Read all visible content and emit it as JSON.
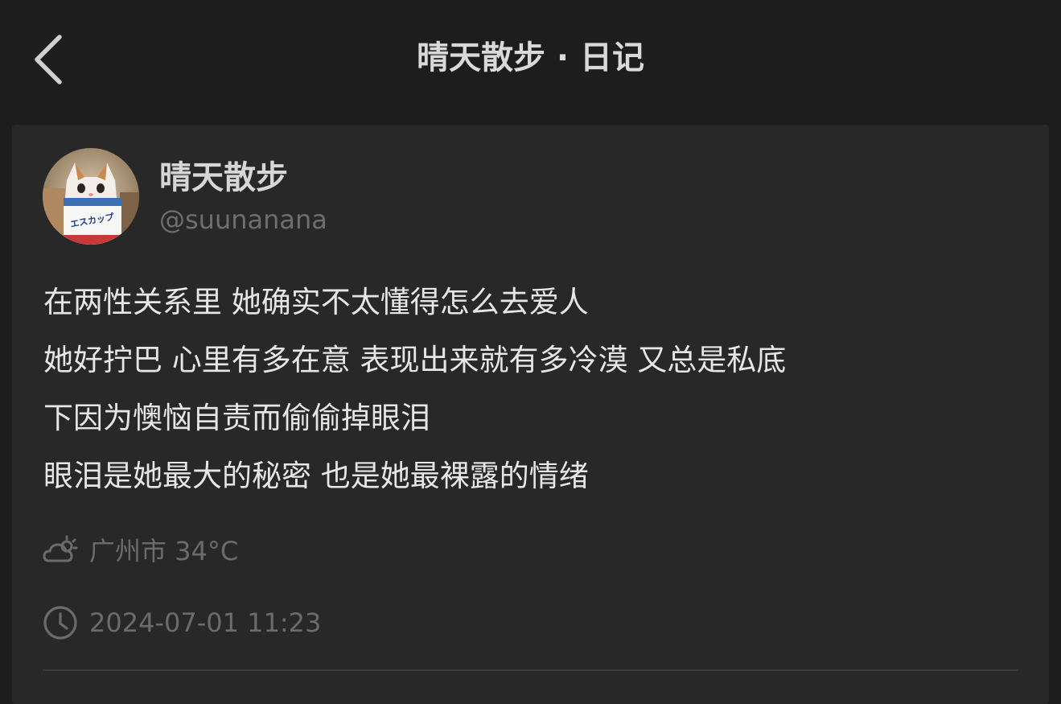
{
  "header": {
    "title": "晴天散步 · 日记",
    "back_icon": "chevron-left-icon"
  },
  "post": {
    "author_name": "晴天散步",
    "author_handle": "@suunanana",
    "avatar_text": "エスカップ",
    "lines": [
      "在两性关系里 她确实不太懂得怎么去爱人",
      "她好拧巴 心里有多在意 表现出来就有多冷漠 又总是私底",
      "下因为懊恼自责而偷偷掉眼泪",
      "眼泪是她最大的秘密 也是她最裸露的情绪"
    ],
    "weather": {
      "icon": "partly-cloudy-icon",
      "text": "广州市 34°C"
    },
    "time": {
      "icon": "clock-icon",
      "text": "2024-07-01 11:23"
    }
  },
  "colors": {
    "background": "#1d1d1d",
    "card": "#282828",
    "text_primary": "#e6e6e6",
    "text_secondary": "#6e6e6e"
  }
}
